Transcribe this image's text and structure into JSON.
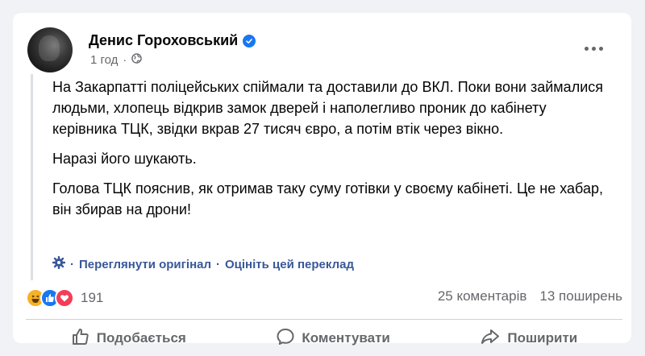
{
  "post": {
    "author": "Денис Гороховський",
    "time": "1 год",
    "paragraphs": [
      "На Закарпатті поліцейських спіймали та доставили до ВКЛ. Поки вони займалися людьми, хлопець відкрив замок дверей і наполегливо проник до кабінету керівника ТЦК, звідки вкрав 27 тисяч євро, а потім втік через вікно.",
      "Наразі його шукають.",
      "Голова ТЦК пояснив, як отримав таку суму готівки у своєму кабінеті. Це не хабар, він збирав на дрони!"
    ],
    "translation": {
      "see_original": "Переглянути оригінал",
      "rate": "Оцініть цей переклад"
    }
  },
  "stats": {
    "reactions_count": "191",
    "comments": "25 коментарів",
    "shares": "13 поширень"
  },
  "actions": {
    "like": "Подобається",
    "comment": "Коментувати",
    "share": "Поширити"
  },
  "colors": {
    "accent": "#1877f2",
    "link": "#385898",
    "secondary_text": "#65676b"
  }
}
